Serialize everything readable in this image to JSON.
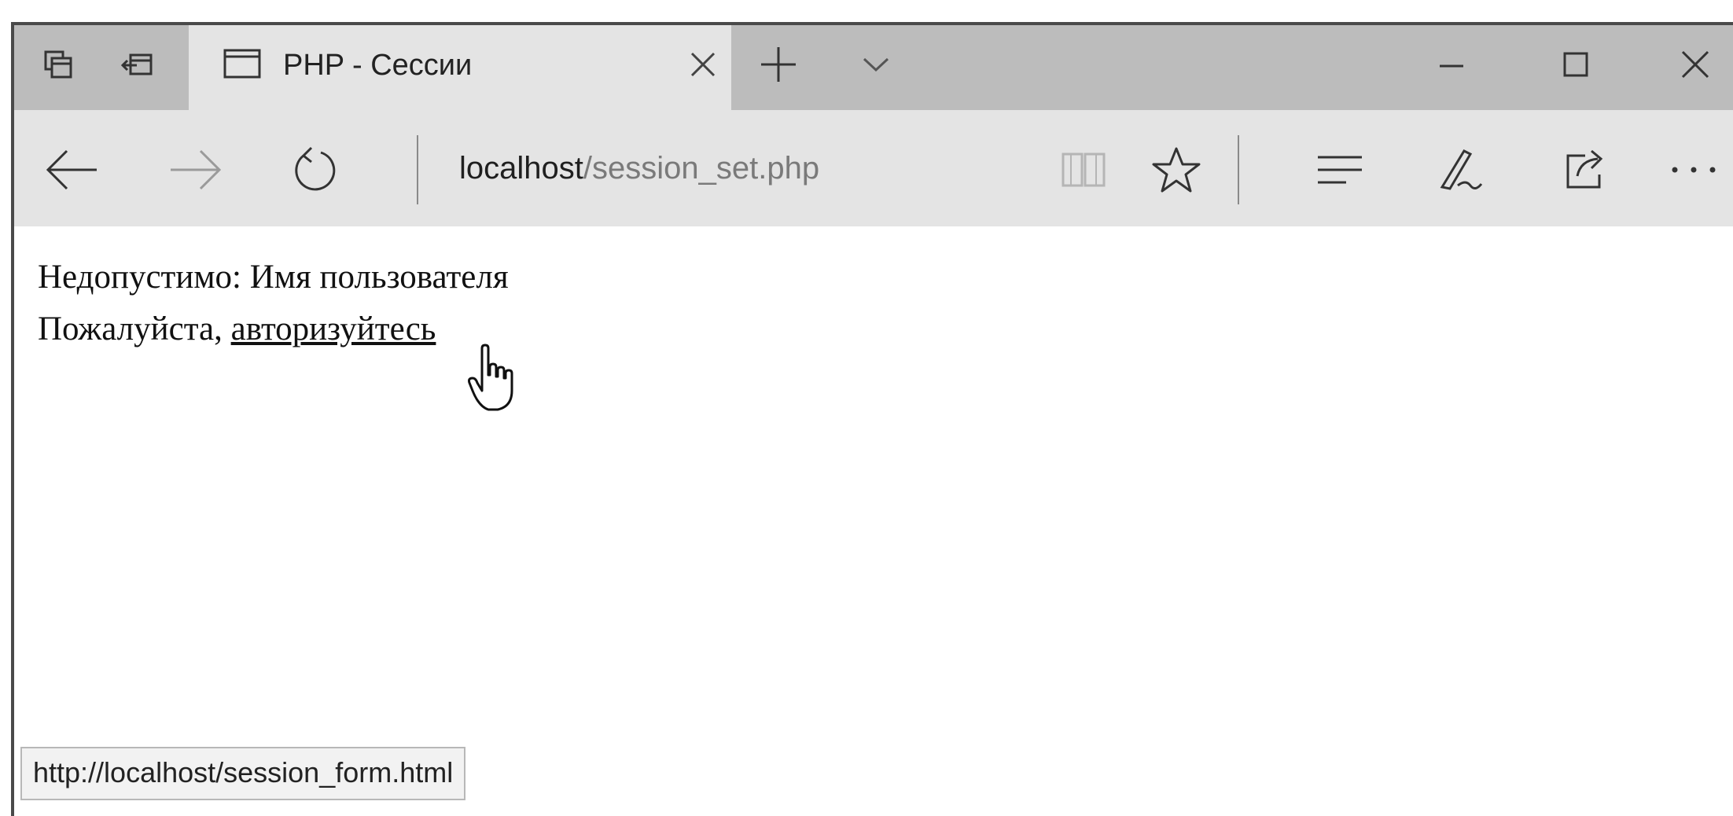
{
  "tab": {
    "title": "PHP - Сессии"
  },
  "addressbar": {
    "host": "localhost",
    "path": "/session_set.php"
  },
  "page": {
    "line1": "Недопустимо: Имя пользователя",
    "line2_prefix": "Пожалуйста, ",
    "link_text": "авторизуйтесь"
  },
  "statusbar": {
    "url": "http://localhost/session_form.html"
  },
  "icons": {
    "tab_actions": "tab-preview-icon",
    "set_aside": "set-aside-icon",
    "new_tab": "plus-icon",
    "tab_list": "chevron-down-icon",
    "minimize": "minimize-icon",
    "maximize": "maximize-icon",
    "close": "close-icon",
    "back": "back-arrow-icon",
    "forward": "forward-arrow-icon",
    "refresh": "refresh-icon",
    "reading_view": "book-icon",
    "favorite": "star-icon",
    "hub": "hub-icon",
    "notes": "pen-icon",
    "share": "share-icon",
    "more": "ellipsis-icon"
  }
}
